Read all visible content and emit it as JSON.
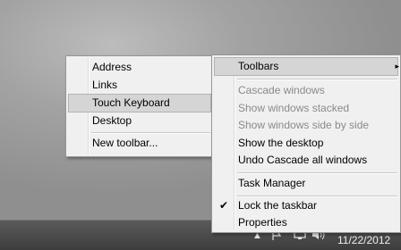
{
  "toolbars_submenu": {
    "items": [
      {
        "label": "Address"
      },
      {
        "label": "Links"
      },
      {
        "label": "Touch Keyboard"
      },
      {
        "label": "Desktop"
      }
    ],
    "new_toolbar": "New toolbar..."
  },
  "context_menu": {
    "toolbars": "Toolbars",
    "cascade": "Cascade windows",
    "stacked": "Show windows stacked",
    "side_by_side": "Show windows side by side",
    "show_desktop": "Show the desktop",
    "undo_cascade": "Undo Cascade all windows",
    "task_manager": "Task Manager",
    "lock_taskbar": "Lock the taskbar",
    "properties": "Properties",
    "check_glyph": "✔",
    "arrow_glyph": "▸"
  },
  "tray": {
    "date": "11/22/2012",
    "icons": [
      "show-hidden-icon",
      "flag-icon",
      "network-icon",
      "volume-icon"
    ]
  }
}
